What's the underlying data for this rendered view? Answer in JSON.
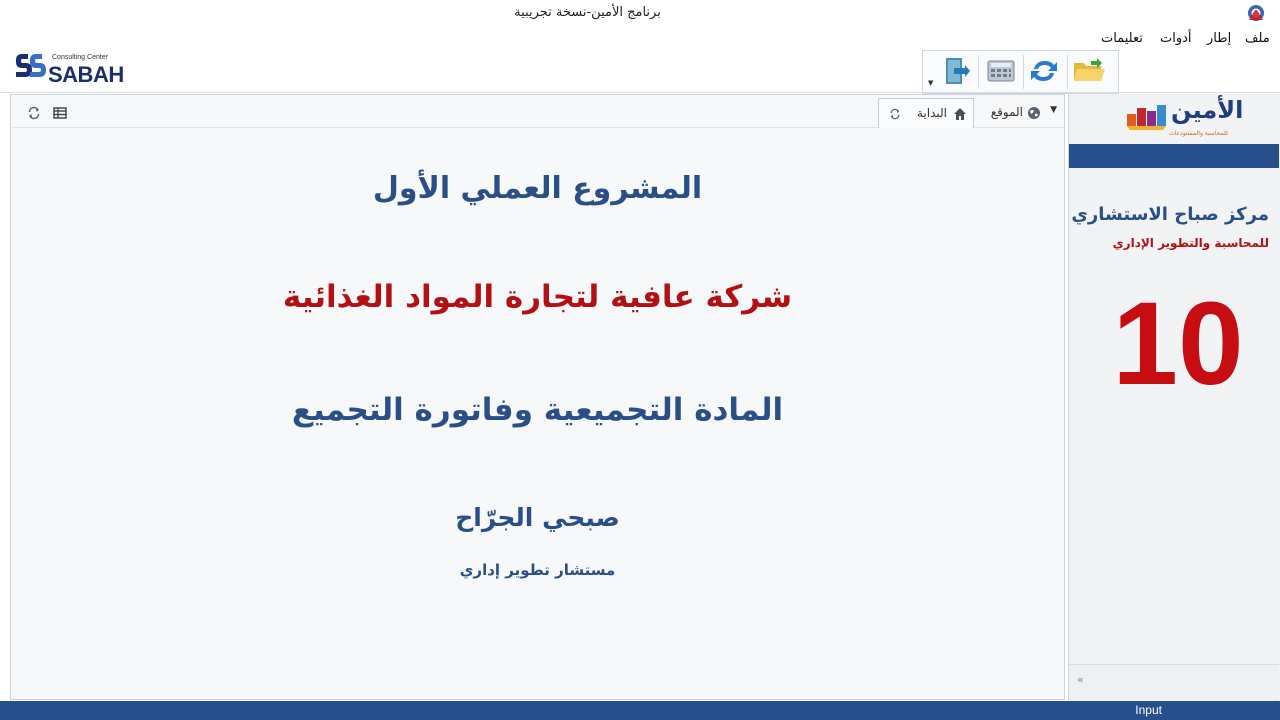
{
  "window": {
    "title": "برنامج الأمين-نسخة تجريبية"
  },
  "menu": {
    "file": "ملف",
    "frame": "إطار",
    "tools": "أدوات",
    "help": "تعليمات"
  },
  "logo": {
    "small_text": "Consulting Center",
    "name": "SABAH"
  },
  "tabs": {
    "location": "الموقع",
    "start": "البداية"
  },
  "content": {
    "line1": "المشروع العملي الأول",
    "line2": "شركة عافية لتجارة المواد الغذائية",
    "line3": "المادة التجميعية وفاتورة التجميع",
    "author": "صبحي الجرّاح",
    "author_title": "مستشار تطوير إداري"
  },
  "side": {
    "logo_word": "الأمين",
    "logo_sub": "للمحاسبة والمستودعات",
    "title": "مركز صباح الاستشاري",
    "subtitle": "للمحاسبة والتطوير الإداري",
    "number": "10"
  },
  "status": {
    "text": "Input"
  },
  "colors": {
    "accent_blue": "#264f8c",
    "heading_blue": "#2a4f86",
    "red": "#b31015"
  },
  "icons": [
    "app-icon",
    "folder-icon",
    "refresh-icon",
    "calculator-icon",
    "exit-icon",
    "globe-icon",
    "home-icon",
    "grid-icon",
    "collapse-icon"
  ]
}
